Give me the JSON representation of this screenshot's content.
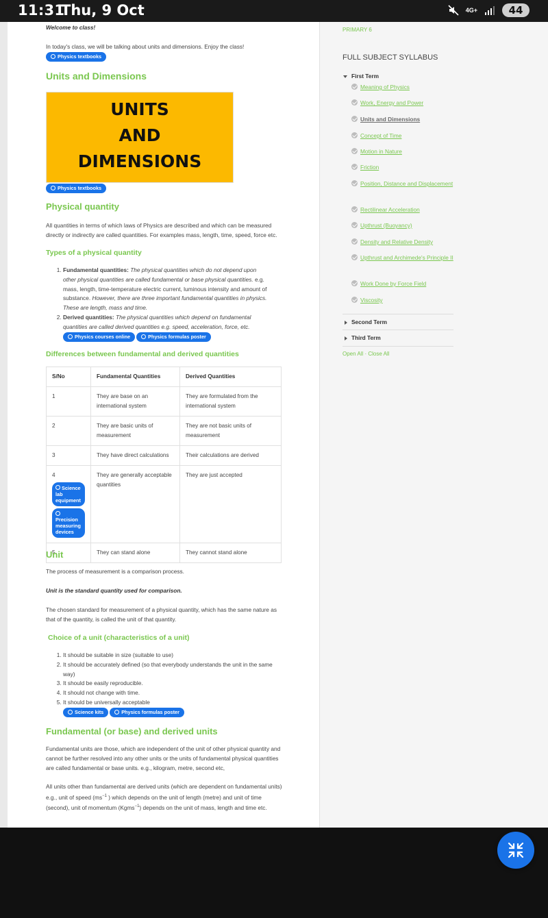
{
  "status_bar": {
    "time": "11:31",
    "date": "Thu, 9 Oct",
    "network": "4G+",
    "battery": "44"
  },
  "content": {
    "welcome": "Welcome to class!",
    "intro": "In today's class, we will be talking about units and dimensions. Enjoy the class!",
    "ad_pill_1": "Physics textbooks",
    "title": "Units and Dimensions",
    "banner": [
      "UNITS",
      "AND",
      "DIMENSIONS"
    ],
    "ad_pill_2": "Physics textbooks",
    "physical_quantity_heading": "Physical quantity",
    "physical_quantity_text": "All quantities in terms of which laws of Physics are described and which can be measured directly or indirectly are called quantities. For examples mass, length, time, speed, force etc.",
    "types_heading": "Types of a physical quantity",
    "types": [
      {
        "label": "Fundamental quantities:",
        "em1": "The physical quantities which do not depend upon other physical quantities are called fundamental or base physical quantities.",
        "text": " e.g. mass, length, time-temperature electric current, luminous intensity and amount of substance.",
        "em2": " However, there are three important fundamental quantities in physics. These are length, mass and time."
      },
      {
        "label": "Derived quantities:",
        "em1": "The physical quantities which depend on fundamental quantities are called derived quantities e.g. speed, acceleration, force, etc.",
        "text": "",
        "em2": ""
      }
    ],
    "ad_pills_types": [
      "Physics courses online",
      "Physics formulas poster"
    ],
    "differences_heading": "Differences between fundamental and derived quantities",
    "table": {
      "headers": [
        "S/No",
        "Fundamental Quantities",
        "Derived Quantities"
      ],
      "rows": [
        [
          "1",
          "They are base on an international system",
          "They are formulated from the international system"
        ],
        [
          "2",
          "They are basic units of measurement",
          "They are not basic units of measurement"
        ],
        [
          "3",
          "They have direct calculations",
          "Their calculations are derived"
        ],
        [
          "4",
          "They are generally acceptable quantities",
          "They are just accepted"
        ],
        [
          "5",
          "They can stand alone",
          "They cannot stand alone"
        ]
      ],
      "row4_pills": [
        "Science lab equipment",
        "Precision measuring devices"
      ]
    },
    "unit_heading": "Unit",
    "unit_text_1": "The process of measurement is a comparison process.",
    "unit_text_2": "Unit is the standard quantity used for comparison.",
    "unit_text_3": "The chosen standard for measurement of a physical quantity, which has the same nature as that of the quantity, is called the unit of that quantity.",
    "choice_heading": "Choice of a unit (characteristics of a unit)",
    "choice_items": [
      "It should be suitable in size (suitable to use)",
      "It should be accurately defined (so that everybody understands the unit in the same way)",
      "It should be easily reproducible.",
      "It should not change with time.",
      "It should be universally acceptable"
    ],
    "ad_pills_choice": [
      "Science kits",
      "Physics formulas poster"
    ],
    "fundamental_units_heading": "Fundamental (or base) and derived units",
    "fundamental_units_text": "Fundamental units are those, which are independent of the unit of other physical quantity and cannot be further resolved into any other units or the units of fundamental physical quantities are called fundamental or base units. e.g., kilogram, metre, second etc,",
    "derived_units_text_a": "All units other than fundamental are derived units (which are dependent on fundamental units) e.g., unit of speed (ms",
    "derived_units_sup1": "−1",
    "derived_units_text_b": " ) which depends on the unit of length (metre) and unit of time (second), unit of momentum (Kgms",
    "derived_units_sup2": "−1",
    "derived_units_text_c": ") depends on the unit of mass, length and time etc."
  },
  "sidebar": {
    "class_link": "PRIMARY 6",
    "syllabus_heading": "FULL SUBJECT SYLLABUS",
    "first_term": "First Term",
    "topics": [
      "Meaning of Physics",
      "Work, Energy and Power",
      "Units and Dimensions",
      "Concept of Time",
      "Motion in Nature",
      "Friction",
      "Position, Distance and Displacement",
      "Rectilinear Acceleration",
      "Upthrust (Buoyancy)",
      "Density and Relative Density",
      "Upthrust and Archimede's Principle II",
      "Work Done by Force Field",
      "Viscosity"
    ],
    "second_term": "Second Term",
    "third_term": "Third Term",
    "open_close": "Open All · Close All"
  },
  "fab_icon": "collapse-arrows-icon",
  "colors": {
    "accent_green": "#7ac74f",
    "pill_blue": "#1a73e8",
    "banner_yellow": "#fcb900"
  }
}
